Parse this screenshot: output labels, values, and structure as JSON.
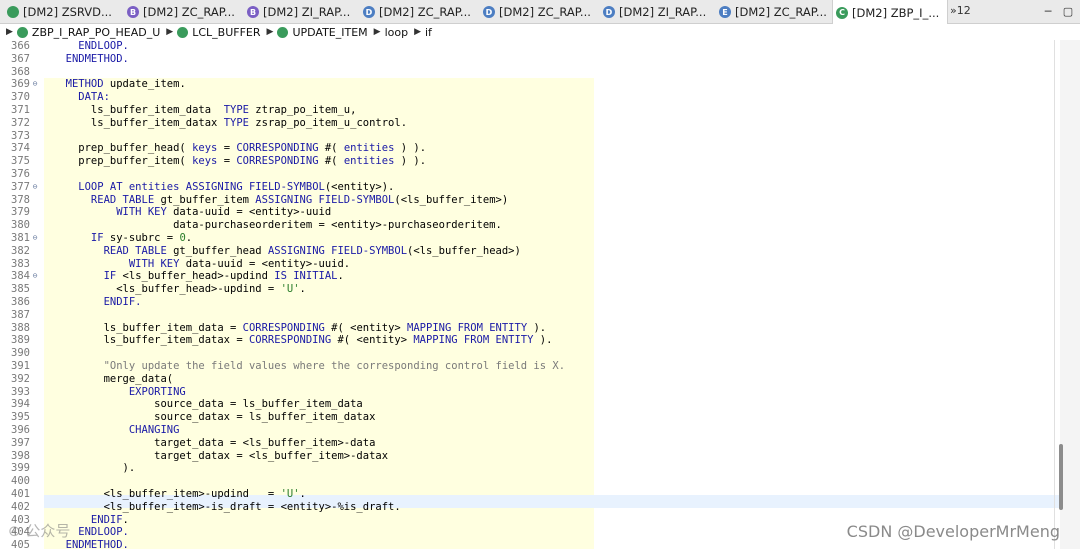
{
  "tabs": [
    {
      "label": "[DM2] ZSRVD...",
      "icon": "service-definition-icon",
      "icon_letter": "",
      "icon_color": "#3a9b5c",
      "active": false
    },
    {
      "label": "[DM2] ZC_RAP...",
      "icon": "behavior-definition-icon",
      "icon_letter": "B",
      "icon_color": "#7b5fc4",
      "active": false
    },
    {
      "label": "[DM2] ZI_RAP...",
      "icon": "behavior-definition-icon",
      "icon_letter": "B",
      "icon_color": "#7b5fc4",
      "active": false
    },
    {
      "label": "[DM2] ZC_RAP...",
      "icon": "data-definition-icon",
      "icon_letter": "D",
      "icon_color": "#4d7ec2",
      "active": false
    },
    {
      "label": "[DM2] ZC_RAP...",
      "icon": "data-definition-icon",
      "icon_letter": "D",
      "icon_color": "#4d7ec2",
      "active": false
    },
    {
      "label": "[DM2] ZI_RAP...",
      "icon": "data-definition-icon",
      "icon_letter": "D",
      "icon_color": "#4d7ec2",
      "active": false
    },
    {
      "label": "[DM2] ZC_RAP...",
      "icon": "metadata-extension-icon",
      "icon_letter": "E",
      "icon_color": "#4d7ec2",
      "active": false
    },
    {
      "label": "[DM2] ZBP_I_...",
      "icon": "abap-class-icon",
      "icon_letter": "C",
      "icon_color": "#3a9b5c",
      "active": true
    }
  ],
  "overflow_label": "»12",
  "breadcrumb": [
    {
      "label": "ZBP_I_RAP_PO_HEAD_U",
      "icon": "class-icon",
      "icon_color": "#3a9b5c"
    },
    {
      "label": "LCL_BUFFER",
      "icon": "local-class-icon",
      "icon_color": "#3a9b5c"
    },
    {
      "label": "UPDATE_ITEM",
      "icon": "method-icon",
      "icon_color": "#3a9b5c"
    },
    {
      "label": "loop",
      "icon": "",
      "icon_color": ""
    },
    {
      "label": "if",
      "icon": "",
      "icon_color": ""
    }
  ],
  "lines": [
    {
      "n": "366",
      "fold": "",
      "code": [
        [
          "kw",
          "    ENDLOOP."
        ]
      ]
    },
    {
      "n": "367",
      "fold": "",
      "code": [
        [
          "kw",
          "  ENDMETHOD."
        ]
      ]
    },
    {
      "n": "368",
      "fold": "",
      "code": []
    },
    {
      "n": "369",
      "fold": "⊖",
      "code": [
        [
          "kw",
          "  METHOD "
        ],
        [
          "",
          "update_item."
        ]
      ]
    },
    {
      "n": "370",
      "fold": "",
      "code": [
        [
          "kw",
          "    DATA:"
        ]
      ]
    },
    {
      "n": "371",
      "fold": "",
      "code": [
        [
          "",
          "      ls_buffer_item_data  "
        ],
        [
          "kw",
          "TYPE "
        ],
        [
          "",
          "ztrap_po_item_u,"
        ]
      ]
    },
    {
      "n": "372",
      "fold": "",
      "code": [
        [
          "",
          "      ls_buffer_item_datax "
        ],
        [
          "kw",
          "TYPE "
        ],
        [
          "",
          "zsrap_po_item_u_control."
        ]
      ]
    },
    {
      "n": "373",
      "fold": "",
      "code": []
    },
    {
      "n": "374",
      "fold": "",
      "code": [
        [
          "",
          "    prep_buffer_head( "
        ],
        [
          "kw",
          "keys "
        ],
        [
          "",
          "= "
        ],
        [
          "kw",
          "CORRESPONDING "
        ],
        [
          "",
          "#( "
        ],
        [
          "kw",
          "entities "
        ],
        [
          "",
          ") )."
        ]
      ]
    },
    {
      "n": "375",
      "fold": "",
      "code": [
        [
          "",
          "    prep_buffer_item( "
        ],
        [
          "kw",
          "keys "
        ],
        [
          "",
          "= "
        ],
        [
          "kw",
          "CORRESPONDING "
        ],
        [
          "",
          "#( "
        ],
        [
          "kw",
          "entities "
        ],
        [
          "",
          ") )."
        ]
      ]
    },
    {
      "n": "376",
      "fold": "",
      "code": []
    },
    {
      "n": "377",
      "fold": "⊖",
      "code": [
        [
          "kw",
          "    LOOP AT "
        ],
        [
          "kw",
          "entities "
        ],
        [
          "kw",
          "ASSIGNING FIELD-SYMBOL"
        ],
        [
          "",
          "(<entity>)."
        ]
      ]
    },
    {
      "n": "378",
      "fold": "",
      "code": [
        [
          "kw",
          "      READ TABLE "
        ],
        [
          "",
          "gt_buffer_item "
        ],
        [
          "kw",
          "ASSIGNING FIELD-SYMBOL"
        ],
        [
          "",
          "(<ls_buffer_item>)"
        ]
      ]
    },
    {
      "n": "379",
      "fold": "",
      "code": [
        [
          "kw",
          "          WITH KEY "
        ],
        [
          "",
          "data-uuid = <entity>-uuid"
        ]
      ]
    },
    {
      "n": "380",
      "fold": "",
      "code": [
        [
          "",
          "                   data-purchaseorderitem = <entity>-purchaseorderitem."
        ]
      ]
    },
    {
      "n": "381",
      "fold": "⊖",
      "code": [
        [
          "kw",
          "      IF "
        ],
        [
          "",
          "sy-subrc = "
        ],
        [
          "nm",
          "0"
        ],
        [
          "",
          "."
        ]
      ]
    },
    {
      "n": "382",
      "fold": "",
      "code": [
        [
          "kw",
          "        READ TABLE "
        ],
        [
          "",
          "gt_buffer_head "
        ],
        [
          "kw",
          "ASSIGNING FIELD-SYMBOL"
        ],
        [
          "",
          "(<ls_buffer_head>)"
        ]
      ]
    },
    {
      "n": "383",
      "fold": "",
      "code": [
        [
          "kw",
          "            WITH KEY "
        ],
        [
          "",
          "data-uuid = <entity>-uuid."
        ]
      ]
    },
    {
      "n": "384",
      "fold": "⊖",
      "code": [
        [
          "kw",
          "        IF "
        ],
        [
          "",
          "<ls_buffer_head>-updind "
        ],
        [
          "kw",
          "IS INITIAL"
        ],
        [
          "",
          "."
        ]
      ]
    },
    {
      "n": "385",
      "fold": "",
      "code": [
        [
          "",
          "          <ls_buffer_head>-updind = "
        ],
        [
          "str",
          "'U'"
        ],
        [
          "",
          "."
        ]
      ]
    },
    {
      "n": "386",
      "fold": "",
      "code": [
        [
          "kw",
          "        ENDIF."
        ]
      ]
    },
    {
      "n": "387",
      "fold": "",
      "code": []
    },
    {
      "n": "388",
      "fold": "",
      "code": [
        [
          "",
          "        ls_buffer_item_data = "
        ],
        [
          "kw",
          "CORRESPONDING "
        ],
        [
          "",
          "#( <entity> "
        ],
        [
          "kw",
          "MAPPING FROM ENTITY "
        ],
        [
          "",
          ")."
        ]
      ]
    },
    {
      "n": "389",
      "fold": "",
      "code": [
        [
          "",
          "        ls_buffer_item_datax = "
        ],
        [
          "kw",
          "CORRESPONDING "
        ],
        [
          "",
          "#( <entity> "
        ],
        [
          "kw",
          "MAPPING FROM ENTITY "
        ],
        [
          "",
          ")."
        ]
      ]
    },
    {
      "n": "390",
      "fold": "",
      "code": []
    },
    {
      "n": "391",
      "fold": "",
      "code": [
        [
          "cm",
          "        \"Only update the field values where the corresponding control field is X."
        ]
      ]
    },
    {
      "n": "392",
      "fold": "",
      "code": [
        [
          "",
          "        merge_data("
        ]
      ]
    },
    {
      "n": "393",
      "fold": "",
      "code": [
        [
          "kw",
          "            EXPORTING"
        ]
      ]
    },
    {
      "n": "394",
      "fold": "",
      "code": [
        [
          "",
          "                source_data = ls_buffer_item_data"
        ]
      ]
    },
    {
      "n": "395",
      "fold": "",
      "code": [
        [
          "",
          "                source_datax = ls_buffer_item_datax"
        ]
      ]
    },
    {
      "n": "396",
      "fold": "",
      "code": [
        [
          "kw",
          "            CHANGING"
        ]
      ]
    },
    {
      "n": "397",
      "fold": "",
      "code": [
        [
          "",
          "                target_data = <ls_buffer_item>-data"
        ]
      ]
    },
    {
      "n": "398",
      "fold": "",
      "code": [
        [
          "",
          "                target_datax = <ls_buffer_item>-datax"
        ]
      ]
    },
    {
      "n": "399",
      "fold": "",
      "code": [
        [
          "",
          "           )."
        ]
      ]
    },
    {
      "n": "400",
      "fold": "",
      "code": []
    },
    {
      "n": "401",
      "fold": "",
      "code": [
        [
          "",
          "        <ls_buffer_item>-updind   = "
        ],
        [
          "str",
          "'U'"
        ],
        [
          "",
          "."
        ]
      ]
    },
    {
      "n": "402",
      "fold": "",
      "code": [
        [
          "",
          "        <ls_buffer_item>-is_draft = <entity>-%is_draft."
        ]
      ]
    },
    {
      "n": "403",
      "fold": "",
      "code": [
        [
          "kw",
          "      ENDIF"
        ],
        [
          "",
          "."
        ]
      ]
    },
    {
      "n": "404",
      "fold": "",
      "code": [
        [
          "kw",
          "    ENDLOOP."
        ]
      ]
    },
    {
      "n": "405",
      "fold": "",
      "code": [
        [
          "kw",
          "  ENDMETHOD."
        ]
      ]
    }
  ],
  "watermark_csdn": "CSDN @DeveloperMrMeng"
}
